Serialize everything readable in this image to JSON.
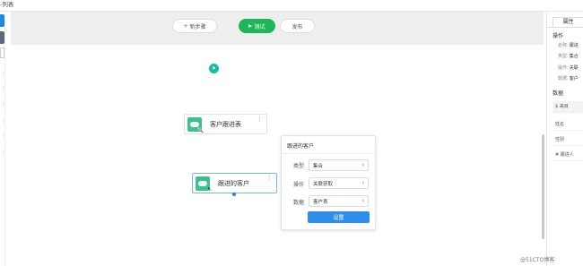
{
  "header": {
    "title_fragment": "-列表"
  },
  "left_rail": {
    "dots": [
      "⋮",
      "⋮",
      "⋮",
      "⋮",
      "⋮",
      "⋮"
    ]
  },
  "toolbar": {
    "add_step_label": "新步骤",
    "add_step_prefix": "+",
    "test_label": "测试",
    "publish_label": "发布"
  },
  "flow": {
    "start_node_glyph": "⚑",
    "node_a": {
      "label": "客户跟进表",
      "sub_icon": "🔍",
      "more": "⋮"
    },
    "node_b": {
      "label": "跟进的客户",
      "sub_icon": "↖",
      "more": "⋮"
    }
  },
  "popover": {
    "title": "跟进的客户",
    "rows": [
      {
        "label": "类型",
        "value": "集合"
      },
      {
        "label": "操作",
        "value": "关联获取"
      },
      {
        "label": "数据",
        "value": "客户表"
      }
    ],
    "confirm_label": "设置"
  },
  "properties_panel": {
    "tab_label": "属性",
    "operation_section": "操作",
    "operation_items": [
      {
        "key": "名称:",
        "value": "跟进"
      },
      {
        "key": "类型:",
        "value": "集合"
      },
      {
        "key": "操作:",
        "value": "关联"
      },
      {
        "key": "数据:",
        "value": "客户"
      }
    ],
    "data_section": "数据",
    "data_fields": [
      "$ 来目",
      "姓名",
      "性别",
      "# 跟进人"
    ]
  },
  "watermark": "@51CTO博客",
  "colors": {
    "primary": "#2e8de6",
    "success": "#21b559",
    "node_icon": "#3fbf8f"
  }
}
